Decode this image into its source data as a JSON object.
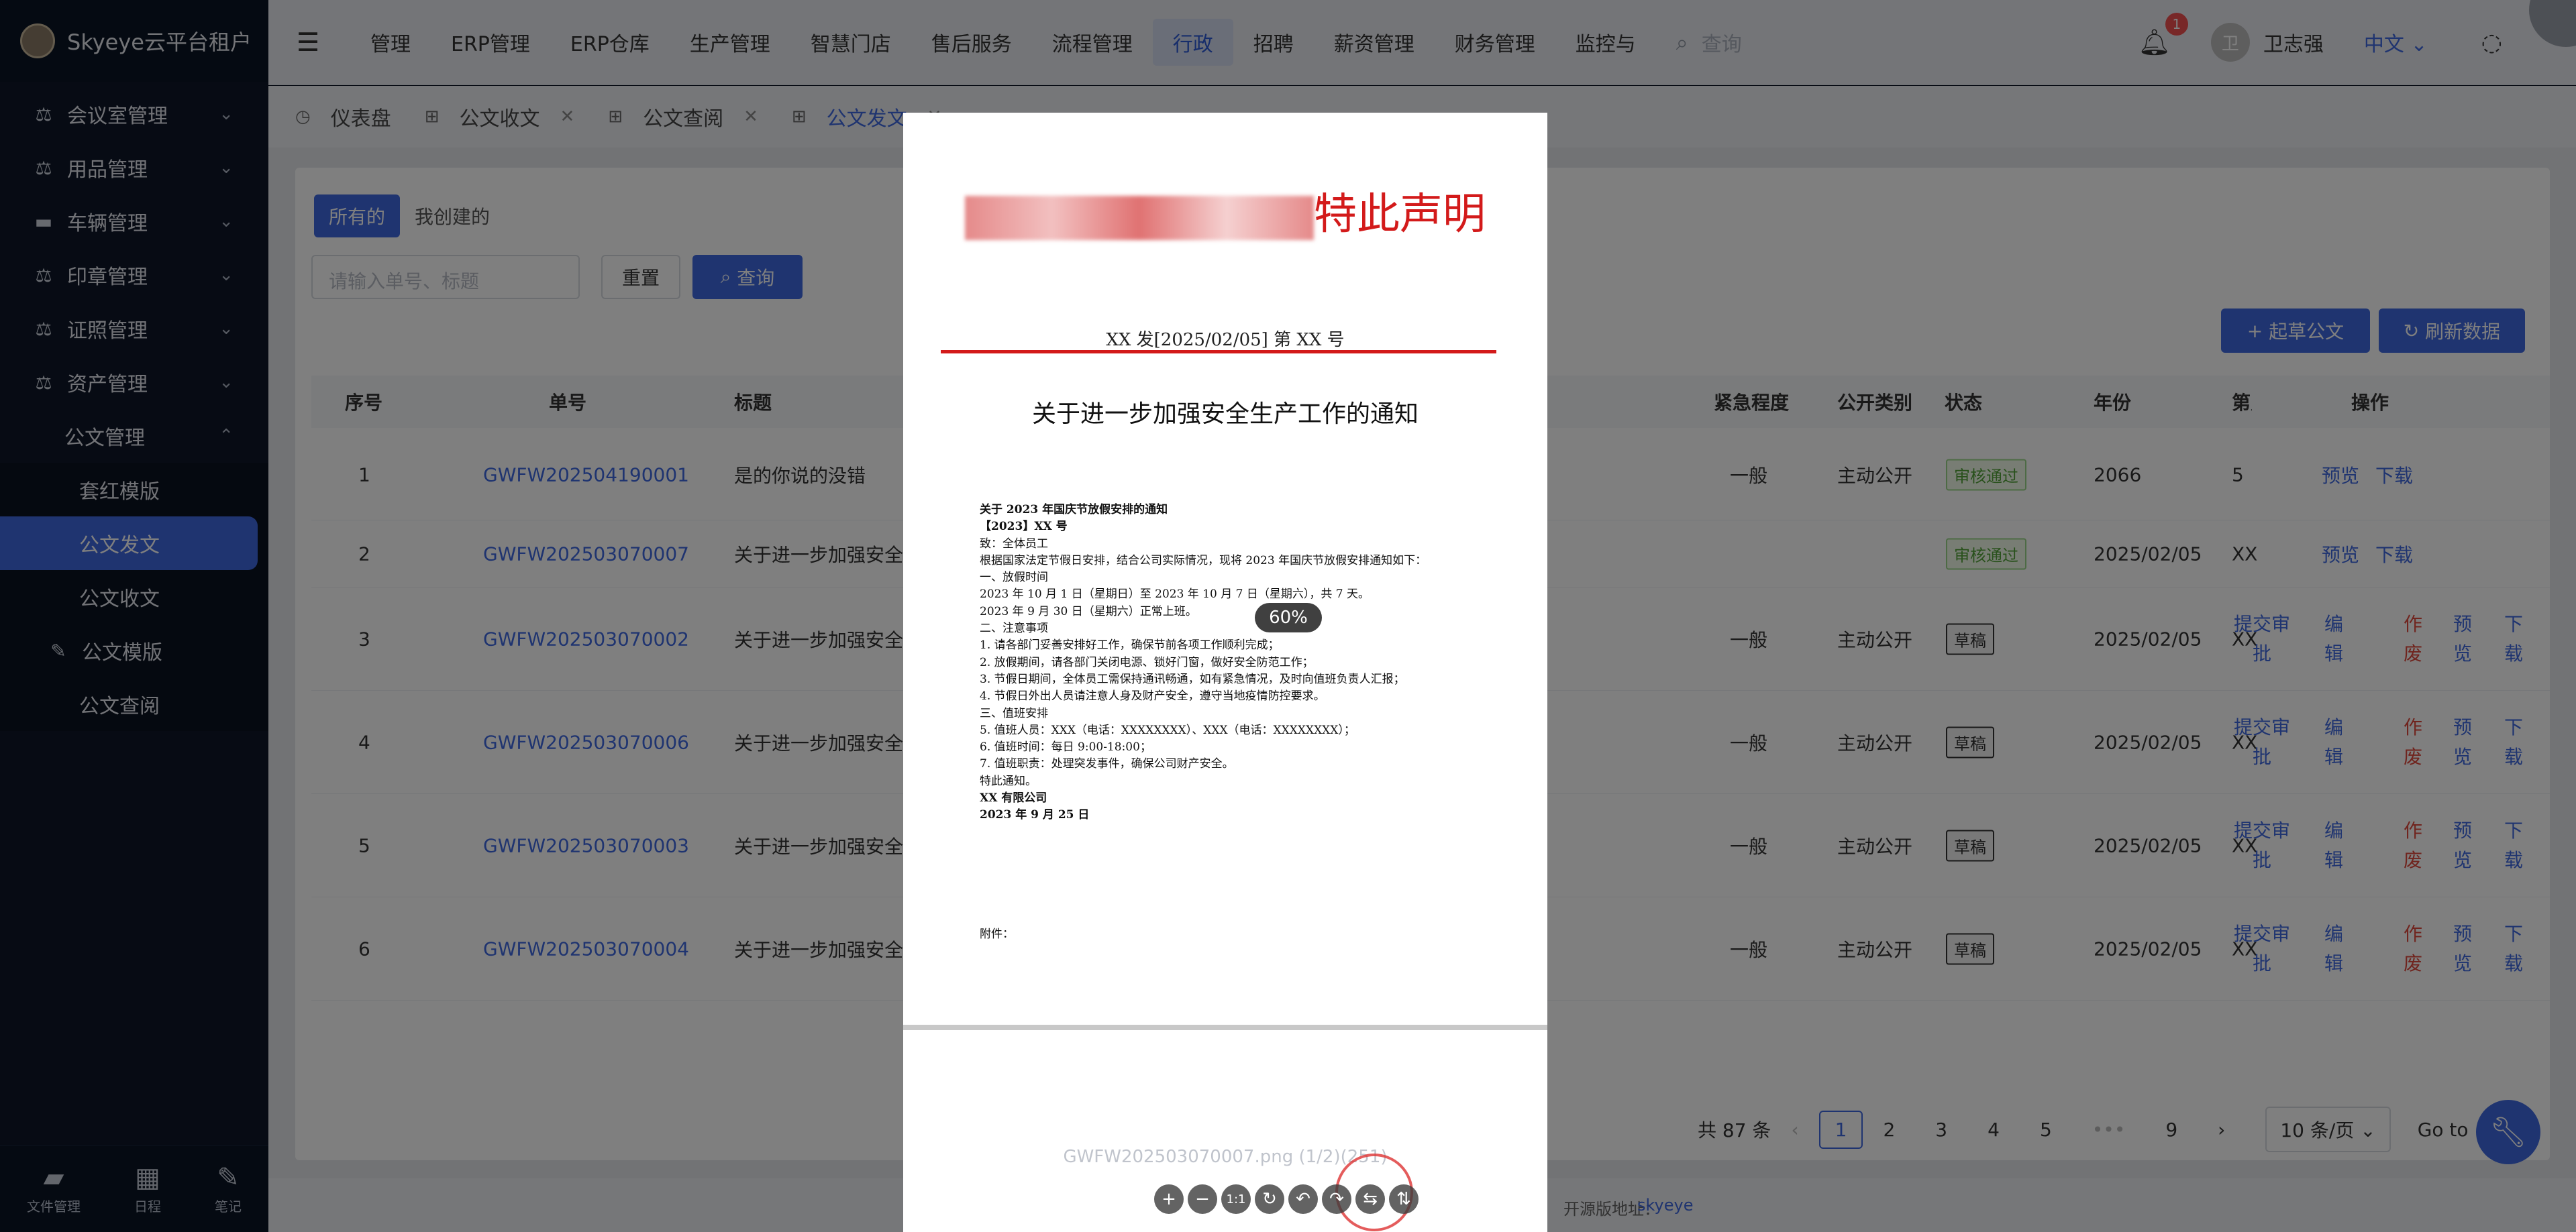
{
  "app": {
    "brand": "Skyeye云平台租户"
  },
  "sidebar": {
    "items": [
      {
        "label": "会议室管理",
        "icon": "scale-icon"
      },
      {
        "label": "用品管理",
        "icon": "scale-icon"
      },
      {
        "label": "车辆管理",
        "icon": "list-icon"
      },
      {
        "label": "印章管理",
        "icon": "scale-icon"
      },
      {
        "label": "证照管理",
        "icon": "scale-icon"
      },
      {
        "label": "资产管理",
        "icon": "scale-icon"
      }
    ],
    "group": {
      "label": "公文管理",
      "children": [
        "套红模版",
        "公文发文",
        "公文收文"
      ]
    },
    "extra": {
      "label": "公文模版"
    },
    "extra2": {
      "label": "公文查阅"
    },
    "bottom": [
      "文件管理",
      "日程",
      "笔记"
    ]
  },
  "topnav": {
    "items": [
      "管理",
      "ERP管理",
      "ERP仓库",
      "生产管理",
      "智慧门店",
      "售后服务",
      "流程管理",
      "行政",
      "招聘",
      "薪资管理",
      "财务管理",
      "监控与"
    ],
    "active": "行政",
    "search_placeholder": "查询",
    "badge": "1",
    "avatar_char": "卫",
    "user": "卫志强",
    "lang": "中文"
  },
  "tabs": [
    "仪表盘",
    "公文收文",
    "公文查阅",
    "公文发文"
  ],
  "filters": {
    "all": "所有的",
    "mine": "我创建的",
    "placeholder": "请输入单号、标题",
    "reset": "重置",
    "query": "查询",
    "new_doc": "起草公文",
    "refresh": "刷新数据"
  },
  "table": {
    "headers": [
      "序号",
      "单号",
      "标题",
      "紧急程度",
      "公开类别",
      "状态",
      "年份",
      "第几",
      "操作"
    ],
    "rows": [
      {
        "no": "1",
        "code": "GWFW202504190001",
        "title": "是的你说的没错",
        "urgency": "一般",
        "public": "主动公开",
        "status": "审核通过",
        "year": "2066",
        "num": "5",
        "ops": [
          "预览",
          "下载"
        ]
      },
      {
        "no": "2",
        "code": "GWFW202503070007",
        "title": "关于进一步加强安全生",
        "urgency": "",
        "public": "",
        "status": "审核通过",
        "year": "2025/02/05",
        "num": "XX",
        "ops": [
          "预览",
          "下载"
        ]
      },
      {
        "no": "3",
        "code": "GWFW202503070002",
        "title": "关于进一步加强安全生",
        "urgency": "一般",
        "public": "主动公开",
        "status": "草稿",
        "year": "2025/02/05",
        "num": "XX",
        "ops": [
          "提交审批",
          "编辑",
          "作废",
          "预览",
          "下载"
        ]
      },
      {
        "no": "4",
        "code": "GWFW202503070006",
        "title": "关于进一步加强安全生",
        "urgency": "一般",
        "public": "主动公开",
        "status": "草稿",
        "year": "2025/02/05",
        "num": "XX",
        "ops": [
          "提交审批",
          "编辑",
          "作废",
          "预览",
          "下载"
        ]
      },
      {
        "no": "5",
        "code": "GWFW202503070003",
        "title": "关于进一步加强安全生",
        "urgency": "一般",
        "public": "主动公开",
        "status": "草稿",
        "year": "2025/02/05",
        "num": "XX",
        "ops": [
          "提交审批",
          "编辑",
          "作废",
          "预览",
          "下载"
        ]
      },
      {
        "no": "6",
        "code": "GWFW202503070004",
        "title": "关于进一步加强安全生",
        "urgency": "一般",
        "public": "主动公开",
        "status": "草稿",
        "year": "2025/02/05",
        "num": "XX",
        "ops": [
          "提交审批",
          "编辑",
          "作废",
          "预览",
          "下载"
        ]
      }
    ]
  },
  "pagination": {
    "total": "共 87 条",
    "pages": [
      "1",
      "2",
      "3",
      "4",
      "5",
      "•••",
      "9"
    ],
    "current": "1",
    "size": "10 条/页",
    "goto": "Go to"
  },
  "footer": {
    "text": "开源版地址：",
    "link": "skyeye"
  },
  "viewer": {
    "header_visible": "特此声明",
    "doc_no": "XX 发[2025/02/05] 第 XX 号",
    "doc_title": "关于进一步加强安全生产工作的通知",
    "body": [
      {
        "t": "关于 2023 年国庆节放假安排的通知",
        "b": true
      },
      {
        "t": "【2023】XX 号",
        "b": true
      },
      {
        "t": "致：全体员工",
        "b": false
      },
      {
        "t": "根据国家法定节假日安排，结合公司实际情况，现将 2023 年国庆节放假安排通知如下：",
        "b": false
      },
      {
        "t": "一、放假时间",
        "b": false
      },
      {
        "t": "2023 年 10 月 1 日（星期日）至 2023 年 10 月 7 日（星期六），共 7 天。",
        "b": false
      },
      {
        "t": "2023 年 9 月 30 日（星期六）正常上班。",
        "b": false
      },
      {
        "t": "二、注意事项",
        "b": false
      },
      {
        "t": "1.    请各部门妥善安排好工作，确保节前各项工作顺利完成；",
        "b": false
      },
      {
        "t": "2.    放假期间，请各部门关闭电源、锁好门窗，做好安全防范工作；",
        "b": false
      },
      {
        "t": "3.    节假日期间，全体员工需保持通讯畅通，如有紧急情况，及时向值班负责人汇报；",
        "b": false
      },
      {
        "t": "4.    节假日外出人员请注意人身及财产安全，遵守当地疫情防控要求。",
        "b": false
      },
      {
        "t": "三、值班安排",
        "b": false
      },
      {
        "t": "5.    值班人员：XXX（电话：XXXXXXXX）、XXX（电话：XXXXXXXX）；",
        "b": false
      },
      {
        "t": "6.    值班时间：每日 9:00-18:00；",
        "b": false
      },
      {
        "t": "7.    值班职责：处理突发事件，确保公司财产安全。",
        "b": false
      },
      {
        "t": "特此通知。",
        "b": false
      },
      {
        "t": "XX 有限公司",
        "b": true
      },
      {
        "t": "2023 年 9 月 25 日",
        "b": true
      }
    ],
    "attach": "附件：",
    "zoom": "60%",
    "filename": "GWFW202503070007.png (1/2)(251)"
  }
}
